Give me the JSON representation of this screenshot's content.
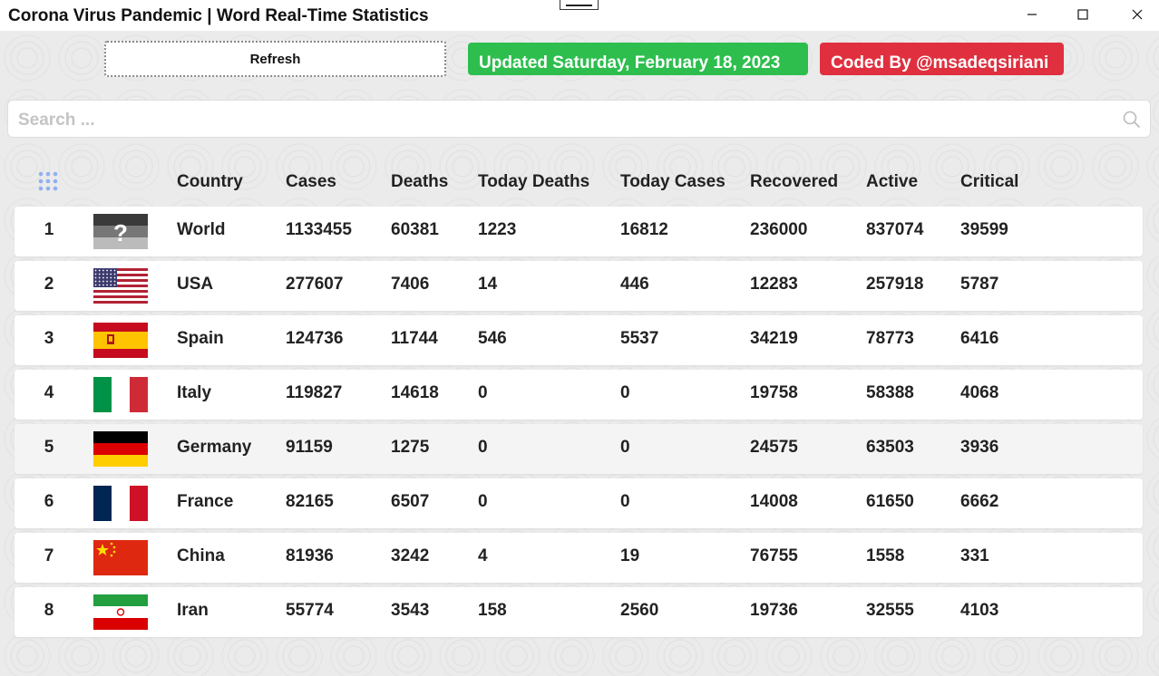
{
  "window": {
    "title": "Corona Virus Pandemic | Word Real-Time Statistics",
    "minimize_icon": "minimize-icon",
    "maximize_icon": "maximize-icon",
    "close_icon": "close-icon"
  },
  "toolbar": {
    "refresh_label": "Refresh",
    "updated_label": "Updated Saturday, February 18, 2023",
    "coded_by_label": "Coded By @msadeqsiriani",
    "updated_color": "#2dbe4e",
    "coded_by_color": "#e0303f"
  },
  "search": {
    "placeholder": "Search ...",
    "value": "",
    "icon": "search-icon"
  },
  "table": {
    "menu_icon": "grid-dots-icon",
    "columns": [
      "Country",
      "Cases",
      "Deaths",
      "Today Deaths",
      "Today Cases",
      "Recovered",
      "Active",
      "Critical"
    ],
    "rows": [
      {
        "rank": "1",
        "flag": "unknown-flag-icon",
        "country": "World",
        "cases": "1133455",
        "deaths": "60381",
        "today_deaths": "1223",
        "today_cases": "16812",
        "recovered": "236000",
        "active": "837074",
        "critical": "39599"
      },
      {
        "rank": "2",
        "flag": "usa-flag-icon",
        "country": "USA",
        "cases": "277607",
        "deaths": "7406",
        "today_deaths": "14",
        "today_cases": "446",
        "recovered": "12283",
        "active": "257918",
        "critical": "5787"
      },
      {
        "rank": "3",
        "flag": "spain-flag-icon",
        "country": "Spain",
        "cases": "124736",
        "deaths": "11744",
        "today_deaths": "546",
        "today_cases": "5537",
        "recovered": "34219",
        "active": "78773",
        "critical": "6416"
      },
      {
        "rank": "4",
        "flag": "italy-flag-icon",
        "country": "Italy",
        "cases": "119827",
        "deaths": "14618",
        "today_deaths": "0",
        "today_cases": "0",
        "recovered": "19758",
        "active": "58388",
        "critical": "4068"
      },
      {
        "rank": "5",
        "flag": "germany-flag-icon",
        "country": "Germany",
        "cases": "91159",
        "deaths": "1275",
        "today_deaths": "0",
        "today_cases": "0",
        "recovered": "24575",
        "active": "63503",
        "critical": "3936"
      },
      {
        "rank": "6",
        "flag": "france-flag-icon",
        "country": "France",
        "cases": "82165",
        "deaths": "6507",
        "today_deaths": "0",
        "today_cases": "0",
        "recovered": "14008",
        "active": "61650",
        "critical": "6662"
      },
      {
        "rank": "7",
        "flag": "china-flag-icon",
        "country": "China",
        "cases": "81936",
        "deaths": "3242",
        "today_deaths": "4",
        "today_cases": "19",
        "recovered": "76755",
        "active": "1558",
        "critical": "331"
      },
      {
        "rank": "8",
        "flag": "iran-flag-icon",
        "country": "Iran",
        "cases": "55774",
        "deaths": "3543",
        "today_deaths": "158",
        "today_cases": "2560",
        "recovered": "19736",
        "active": "32555",
        "critical": "4103"
      }
    ]
  }
}
